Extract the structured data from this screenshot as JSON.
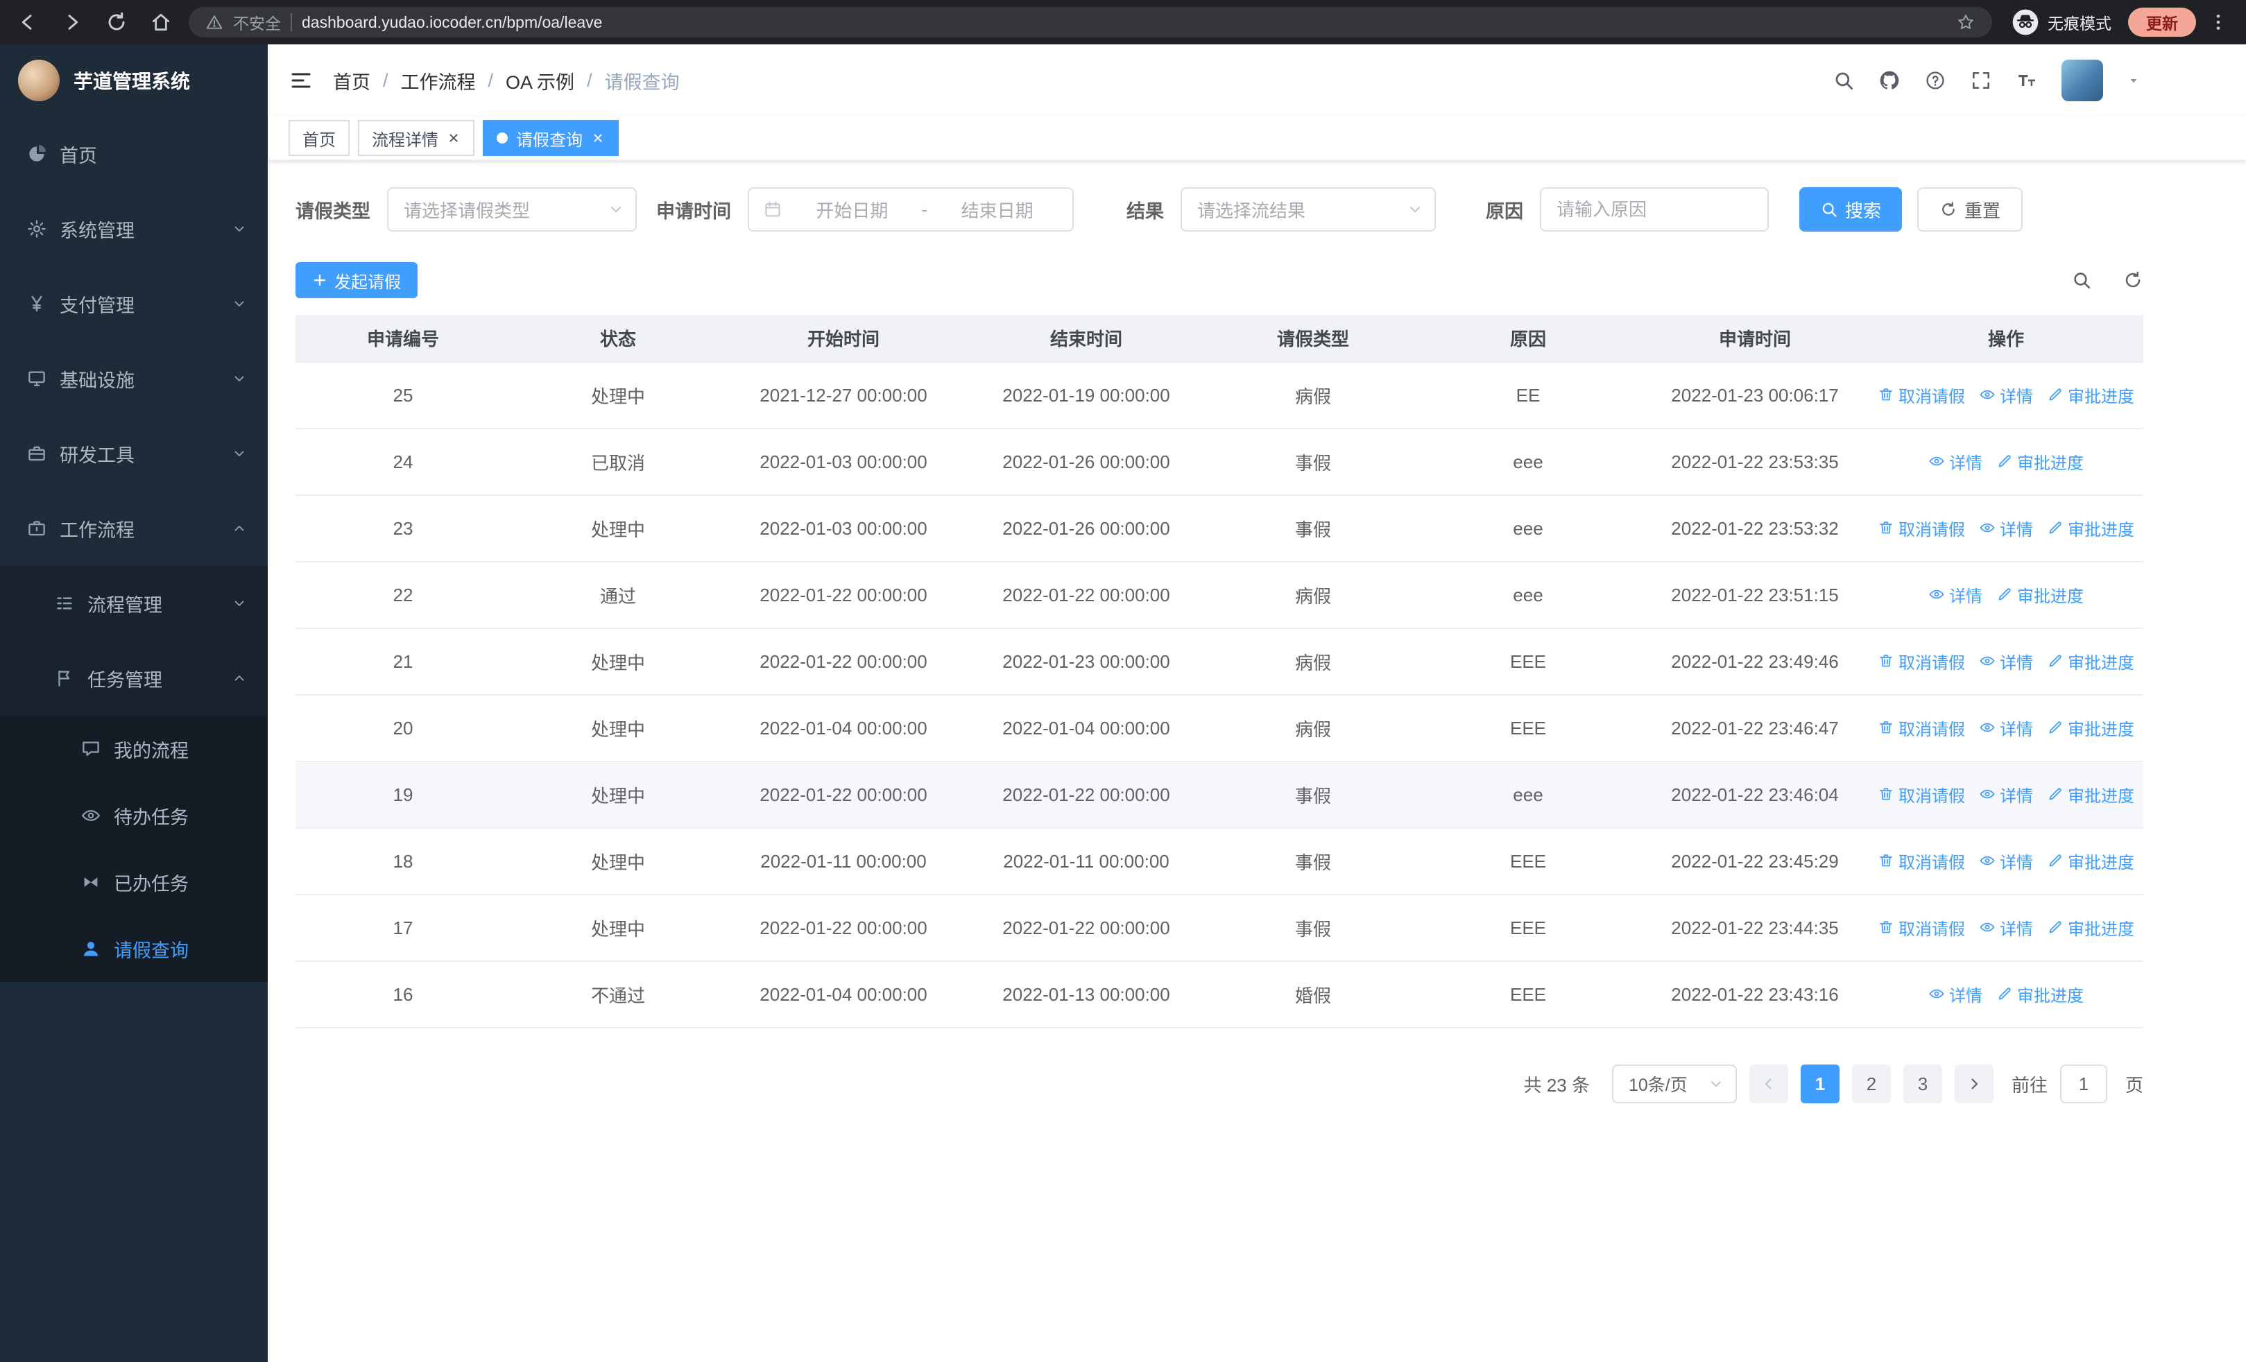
{
  "browser": {
    "security_label": "不安全",
    "url": "dashboard.yudao.iocoder.cn/bpm/oa/leave",
    "incognito_label": "无痕模式",
    "update_label": "更新",
    "nav_icons": [
      "back",
      "forward",
      "reload",
      "home"
    ]
  },
  "sidebar": {
    "app_title": "芋道管理系统",
    "items": [
      {
        "key": "home",
        "label": "首页",
        "icon": "dashboard"
      },
      {
        "key": "system",
        "label": "系统管理",
        "icon": "gear",
        "chevron": "down"
      },
      {
        "key": "payment",
        "label": "支付管理",
        "icon": "yen",
        "chevron": "down"
      },
      {
        "key": "infrastructure",
        "label": "基础设施",
        "icon": "monitor",
        "chevron": "down"
      },
      {
        "key": "devtools",
        "label": "研发工具",
        "icon": "toolbox",
        "chevron": "down"
      },
      {
        "key": "workflow",
        "label": "工作流程",
        "icon": "briefcase",
        "chevron": "up"
      }
    ],
    "workflow_children": [
      {
        "key": "process-management",
        "label": "流程管理",
        "icon": "tree",
        "chevron": "down"
      },
      {
        "key": "task-management",
        "label": "任务管理",
        "icon": "flag",
        "chevron": "up"
      }
    ],
    "task_children": [
      {
        "key": "my-processes",
        "label": "我的流程",
        "icon": "chat"
      },
      {
        "key": "todo-tasks",
        "label": "待办任务",
        "icon": "eye"
      },
      {
        "key": "done-tasks",
        "label": "已办任务",
        "icon": "bowtie"
      },
      {
        "key": "leave-query",
        "label": "请假查询",
        "icon": "user",
        "active": true
      }
    ]
  },
  "header": {
    "breadcrumb": [
      "首页",
      "工作流程",
      "OA 示例",
      "请假查询"
    ],
    "breadcrumb_separator": "/",
    "action_icons": [
      "search",
      "github",
      "help",
      "fullscreen",
      "font-size"
    ]
  },
  "tabs": [
    {
      "key": "home",
      "label": "首页"
    },
    {
      "key": "process-detail",
      "label": "流程详情",
      "closable": true
    },
    {
      "key": "leave-query",
      "label": "请假查询",
      "closable": true,
      "active": true
    }
  ],
  "filters": {
    "leave_type": {
      "label": "请假类型",
      "placeholder": "请选择请假类型"
    },
    "apply_time": {
      "label": "申请时间",
      "start_placeholder": "开始日期",
      "separator": "-",
      "end_placeholder": "结束日期"
    },
    "result": {
      "label": "结果",
      "placeholder": "请选择流结果"
    },
    "reason": {
      "label": "原因",
      "placeholder": "请输入原因"
    },
    "search_label": "搜索",
    "reset_label": "重置"
  },
  "toolbar": {
    "create_label": "发起请假"
  },
  "table": {
    "headers": [
      "申请编号",
      "状态",
      "开始时间",
      "结束时间",
      "请假类型",
      "原因",
      "申请时间",
      "操作"
    ],
    "column_keys": [
      "apply_id",
      "status",
      "start_time",
      "end_time",
      "leave_type",
      "reason",
      "apply_time",
      "ops"
    ],
    "action_defs": {
      "cancel": {
        "label": "取消请假",
        "icon": "trash",
        "name": "cancel-leave-link"
      },
      "detail": {
        "label": "详情",
        "icon": "eye",
        "name": "detail-link"
      },
      "progress": {
        "label": "审批进度",
        "icon": "pen",
        "name": "approval-progress-link"
      }
    },
    "rows": [
      {
        "apply_id": "25",
        "status": "处理中",
        "start_time": "2021-12-27 00:00:00",
        "end_time": "2022-01-19 00:00:00",
        "leave_type": "病假",
        "reason": "EE",
        "apply_time": "2022-01-23 00:06:17",
        "actions": [
          "cancel",
          "detail",
          "progress"
        ]
      },
      {
        "apply_id": "24",
        "status": "已取消",
        "start_time": "2022-01-03 00:00:00",
        "end_time": "2022-01-26 00:00:00",
        "leave_type": "事假",
        "reason": "eee",
        "apply_time": "2022-01-22 23:53:35",
        "actions": [
          "detail",
          "progress"
        ]
      },
      {
        "apply_id": "23",
        "status": "处理中",
        "start_time": "2022-01-03 00:00:00",
        "end_time": "2022-01-26 00:00:00",
        "leave_type": "事假",
        "reason": "eee",
        "apply_time": "2022-01-22 23:53:32",
        "actions": [
          "cancel",
          "detail",
          "progress"
        ]
      },
      {
        "apply_id": "22",
        "status": "通过",
        "start_time": "2022-01-22 00:00:00",
        "end_time": "2022-01-22 00:00:00",
        "leave_type": "病假",
        "reason": "eee",
        "apply_time": "2022-01-22 23:51:15",
        "actions": [
          "detail",
          "progress"
        ]
      },
      {
        "apply_id": "21",
        "status": "处理中",
        "start_time": "2022-01-22 00:00:00",
        "end_time": "2022-01-23 00:00:00",
        "leave_type": "病假",
        "reason": "EEE",
        "apply_time": "2022-01-22 23:49:46",
        "actions": [
          "cancel",
          "detail",
          "progress"
        ]
      },
      {
        "apply_id": "20",
        "status": "处理中",
        "start_time": "2022-01-04 00:00:00",
        "end_time": "2022-01-04 00:00:00",
        "leave_type": "病假",
        "reason": "EEE",
        "apply_time": "2022-01-22 23:46:47",
        "actions": [
          "cancel",
          "detail",
          "progress"
        ]
      },
      {
        "apply_id": "19",
        "status": "处理中",
        "start_time": "2022-01-22 00:00:00",
        "end_time": "2022-01-22 00:00:00",
        "leave_type": "事假",
        "reason": "eee",
        "apply_time": "2022-01-22 23:46:04",
        "actions": [
          "cancel",
          "detail",
          "progress"
        ],
        "highlight": true
      },
      {
        "apply_id": "18",
        "status": "处理中",
        "start_time": "2022-01-11 00:00:00",
        "end_time": "2022-01-11 00:00:00",
        "leave_type": "事假",
        "reason": "EEE",
        "apply_time": "2022-01-22 23:45:29",
        "actions": [
          "cancel",
          "detail",
          "progress"
        ]
      },
      {
        "apply_id": "17",
        "status": "处理中",
        "start_time": "2022-01-22 00:00:00",
        "end_time": "2022-01-22 00:00:00",
        "leave_type": "事假",
        "reason": "EEE",
        "apply_time": "2022-01-22 23:44:35",
        "actions": [
          "cancel",
          "detail",
          "progress"
        ]
      },
      {
        "apply_id": "16",
        "status": "不通过",
        "start_time": "2022-01-04 00:00:00",
        "end_time": "2022-01-13 00:00:00",
        "leave_type": "婚假",
        "reason": "EEE",
        "apply_time": "2022-01-22 23:43:16",
        "actions": [
          "detail",
          "progress"
        ]
      }
    ]
  },
  "pagination": {
    "total": "共 23 条",
    "page_size": "10条/页",
    "pages": [
      "1",
      "2",
      "3"
    ],
    "active_page": "1",
    "goto_label": "前往",
    "goto_value": "1",
    "unit_label": "页"
  },
  "colors": {
    "primary": "#409eff",
    "sidebar_bg": "#1e2b38",
    "table_header_bg": "#f0f2f5"
  },
  "icons": {
    "search-icon": "magnifier",
    "github-icon": "octocat mark",
    "help-icon": "question circle",
    "fullscreen-icon": "expand corners",
    "font-size-icon": "large T small T",
    "gear-icon": "cogwheel",
    "trash-icon": "delete",
    "eye-icon": "view",
    "pen-icon": "edit",
    "calendar-icon": "date picker",
    "chevron-down-icon": "v",
    "chevron-up-icon": "^",
    "close-icon": "x",
    "plus-icon": "+",
    "refresh-icon": "circular arrow",
    "warning-icon": "triangle !",
    "star-icon": "bookmark star",
    "incognito-icon": "spy face",
    "kebab-menu-icon": "vertical dots"
  }
}
